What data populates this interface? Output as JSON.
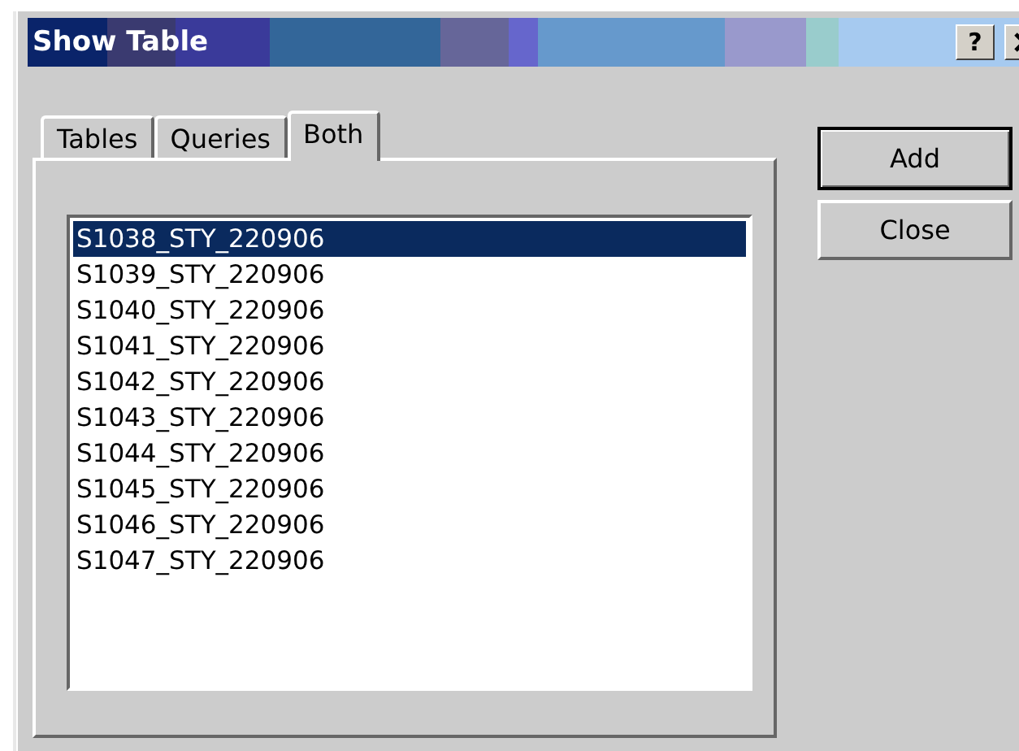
{
  "window": {
    "title": "Show Table",
    "help_button": "?"
  },
  "tabs": [
    {
      "label": "Tables",
      "selected": false
    },
    {
      "label": "Queries",
      "selected": false
    },
    {
      "label": "Both",
      "selected": true
    }
  ],
  "list": {
    "items": [
      {
        "label": "S1038_STY_220906",
        "selected": true
      },
      {
        "label": "S1039_STY_220906",
        "selected": false
      },
      {
        "label": "S1040_STY_220906",
        "selected": false
      },
      {
        "label": "S1041_STY_220906",
        "selected": false
      },
      {
        "label": "S1042_STY_220906",
        "selected": false
      },
      {
        "label": "S1043_STY_220906",
        "selected": false
      },
      {
        "label": "S1044_STY_220906",
        "selected": false
      },
      {
        "label": "S1045_STY_220906",
        "selected": false
      },
      {
        "label": "S1046_STY_220906",
        "selected": false
      },
      {
        "label": "S1047_STY_220906",
        "selected": false
      }
    ]
  },
  "buttons": [
    {
      "label": "Add",
      "default": true
    },
    {
      "label": "Close",
      "default": false
    }
  ]
}
